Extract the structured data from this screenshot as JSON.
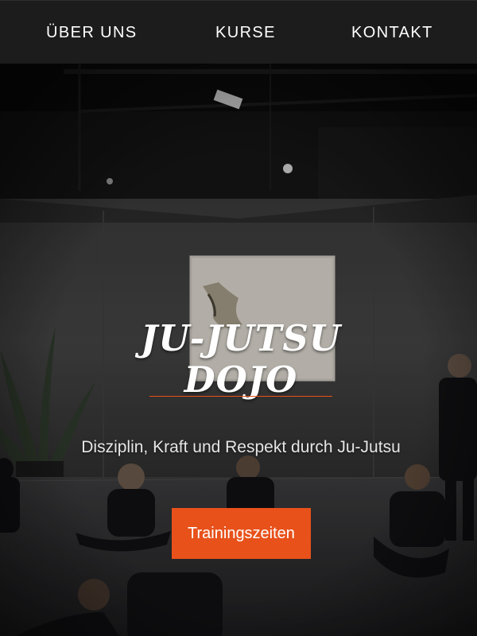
{
  "nav": {
    "items": [
      {
        "label": "ÜBER UNS"
      },
      {
        "label": "KURSE"
      },
      {
        "label": "KONTAKT"
      }
    ]
  },
  "hero": {
    "title_line1": "JU-JUTSU",
    "title_line2": "DOJO",
    "subtitle": "Disziplin, Kraft und Respekt durch Ju-Jutsu",
    "cta_label": "Trainingszeiten"
  },
  "colors": {
    "accent": "#e8511a",
    "navbar": "#1c1c1c",
    "text": "#ffffff"
  }
}
